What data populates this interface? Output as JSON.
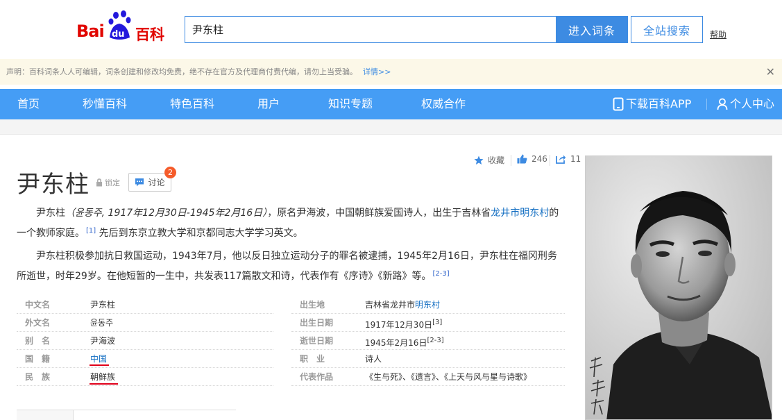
{
  "header": {
    "logo_text_bai": "Bai",
    "logo_text_du": "du",
    "logo_text_baike": "百科",
    "search_value": "尹东柱",
    "enter_button": "进入词条",
    "site_search_button": "全站搜索",
    "help_link": "帮助"
  },
  "notice": {
    "text": "声明：百科词条人人可编辑，词条创建和修改均免费，绝不存在官方及代理商付费代编，请勿上当受骗。",
    "more": "详情>>",
    "close_glyph": "✕"
  },
  "nav": {
    "items": [
      "首页",
      "秒懂百科",
      "特色百科",
      "用户",
      "知识专题",
      "权威合作"
    ],
    "download_app": "下载百科APP",
    "user_center": "个人中心"
  },
  "tools": {
    "favorite": "收藏",
    "likes": "246",
    "shares": "11"
  },
  "entry": {
    "title": "尹东柱",
    "lock_label": "锁定",
    "discuss_label": "讨论",
    "discuss_badge": "2"
  },
  "para1": {
    "name": "尹东柱",
    "korean": "（윤동주, 1917年12月30日-1945年2月16日）",
    "text1": "，原名尹海波，中国朝鲜族爱国诗人，出生于吉林省",
    "link": "龙井市明东村",
    "text2": "的一个教师家庭。",
    "ref1": "[1]",
    "text3": " 先后到东京立教大学和京都同志大学学习英文。"
  },
  "para2": {
    "text": "尹东柱积极参加抗日救国运动，1943年7月，他以反日独立运动分子的罪名被逮捕，1945年2月16日，尹东柱在福冈刑务所逝世，时年29岁。在他短暂的一生中，共发表117篇散文和诗，代表作有《序诗》《新路》等。",
    "ref": "[2-3]"
  },
  "info_left": [
    {
      "key": "中文名",
      "value": "尹东柱"
    },
    {
      "key": "外文名",
      "value": "윤동주"
    },
    {
      "key": "别　名",
      "value": "尹海波"
    },
    {
      "key": "国　籍",
      "value": "中国"
    },
    {
      "key": "民　族",
      "value": "朝鲜族"
    }
  ],
  "info_right": {
    "birthplace_key": "出生地",
    "birthplace_prefix": "吉林省龙井市",
    "birthplace_link": "明东村",
    "birthdate_key": "出生日期",
    "birthdate_value": "1917年12月30日",
    "birthdate_ref": "[3]",
    "deathdate_key": "逝世日期",
    "deathdate_value": "1945年2月16日",
    "deathdate_ref": "[2-3]",
    "job_key": "职　业",
    "job_value": "诗人",
    "works_key": "代表作品",
    "works_value": "《生与死》、《遗言》、《上天与风与星与诗歌》"
  },
  "colors": {
    "brand_blue": "#459df5",
    "button_blue": "#3d8be2",
    "logo_red": "#e10601",
    "logo_blue": "#2319dc",
    "link_blue": "#136ec2",
    "highlight_red": "#e0001a"
  }
}
